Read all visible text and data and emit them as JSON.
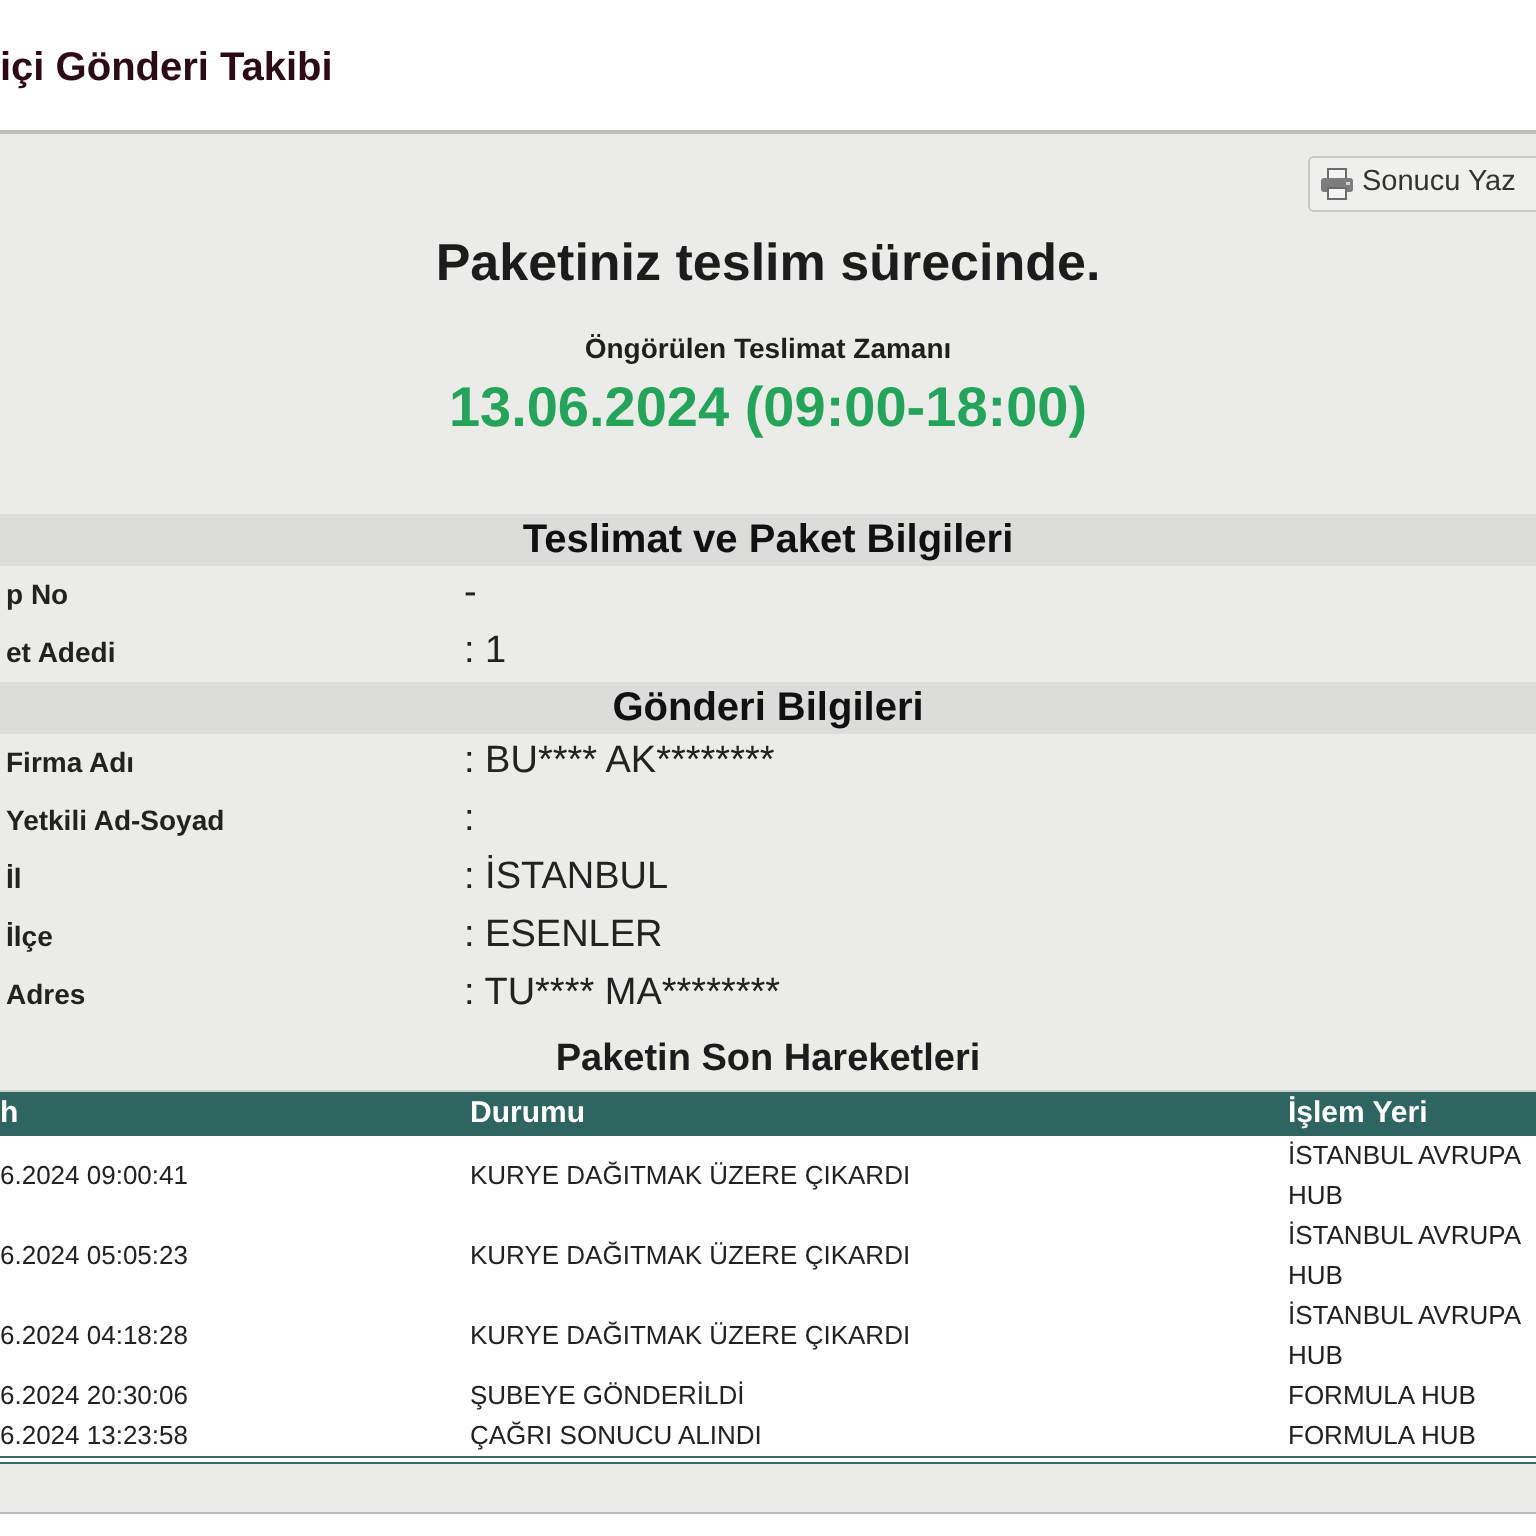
{
  "page_title": "içi Gönderi Takibi",
  "print_button": {
    "label": "Sonucu Yaz"
  },
  "status": {
    "headline": "Paketiniz teslim sürecinde.",
    "eta_label": "Öngörülen Teslimat Zamanı",
    "eta_value": "13.06.2024 (09:00-18:00)"
  },
  "sections": [
    {
      "title": "Teslimat ve Paket Bilgileri",
      "fields": [
        {
          "label": "p No",
          "value": "-"
        },
        {
          "label": "et Adedi",
          "value": ": 1"
        }
      ]
    },
    {
      "title": "Gönderi Bilgileri",
      "fields": [
        {
          "label": "Firma Adı",
          "value": ": BU**** AK********"
        },
        {
          "label": "Yetkili Ad-Soyad",
          "value": ":"
        },
        {
          "label": "İl",
          "value": ": İSTANBUL"
        },
        {
          "label": "İlçe",
          "value": ": ESENLER"
        },
        {
          "label": "Adres",
          "value": ": TU**** MA********"
        }
      ]
    }
  ],
  "movements": {
    "title": "Paketin Son Hareketleri",
    "columns": [
      "h",
      "Durumu",
      "İşlem Yeri"
    ],
    "rows": [
      [
        "6.2024 09:00:41",
        "KURYE DAĞITMAK ÜZERE ÇIKARDI",
        "İSTANBUL AVRUPA HUB"
      ],
      [
        "6.2024 05:05:23",
        "KURYE DAĞITMAK ÜZERE ÇIKARDI",
        "İSTANBUL AVRUPA HUB"
      ],
      [
        "6.2024 04:18:28",
        "KURYE DAĞITMAK ÜZERE ÇIKARDI",
        "İSTANBUL AVRUPA HUB"
      ],
      [
        "6.2024 20:30:06",
        "ŞUBEYE GÖNDERİLDİ",
        "FORMULA HUB"
      ],
      [
        "6.2024 13:23:58",
        "ÇAĞRI SONUCU ALINDI",
        "FORMULA HUB"
      ]
    ]
  }
}
